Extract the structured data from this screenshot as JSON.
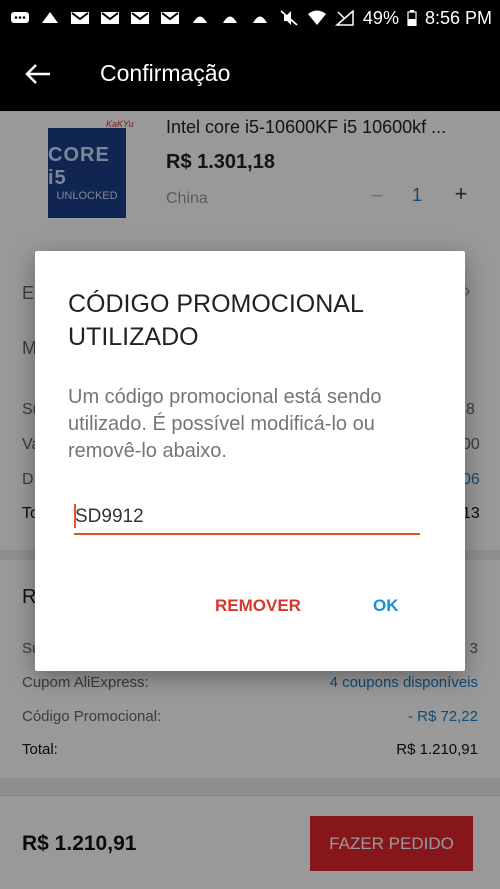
{
  "status_bar": {
    "battery": "49%",
    "time": "8:56 PM",
    "left_icons": [
      "chat-icon",
      "cloud-icon",
      "gmail-icon",
      "gmail-icon",
      "gmail-icon",
      "gmail-icon",
      "app-icon",
      "app-icon",
      "app-icon"
    ],
    "right_icons": [
      "mute-icon",
      "wifi-icon",
      "no-signal-icon",
      "battery-icon"
    ]
  },
  "header": {
    "title": "Confirmação"
  },
  "product": {
    "name": "Intel core i5-10600KF i5 10600kf ...",
    "price": "R$ 1.301,18",
    "origin": "China",
    "quantity": "1",
    "image_text_main": "CORE i5",
    "image_text_sub": "UNLOCKED",
    "seller_tag": "KaKYu"
  },
  "background_fragments": {
    "line1": "E",
    "line2": "M",
    "line3": "Su",
    "line3_v": "8",
    "line4": "Va",
    "line4_v": "00",
    "line5": "D",
    "line5_v": "06",
    "line6": "To",
    "line6_v": "13"
  },
  "summary": {
    "title": "R",
    "rows": [
      {
        "label": "Su",
        "value": "3"
      },
      {
        "label": "Cupom AliExpress:",
        "value": "4 coupons disponíveis"
      },
      {
        "label": "Código Promocional:",
        "value": "- R$ 72,22"
      },
      {
        "label": "Total:",
        "value": "R$ 1.210,91"
      }
    ]
  },
  "bottom_bar": {
    "total": "R$ 1.210,91",
    "order_button": "FAZER PEDIDO"
  },
  "dialog": {
    "title": "CÓDIGO PROMOCIONAL UTILIZADO",
    "message": "Um código promocional está sendo utilizado. É possível modificá-lo ou removê-lo abaixo.",
    "code_value": "SD9912",
    "remove_label": "REMOVER",
    "ok_label": "OK"
  },
  "colors": {
    "accent_red": "#e1252e",
    "link_blue": "#1a8fd1",
    "input_underline": "#e1512a"
  }
}
